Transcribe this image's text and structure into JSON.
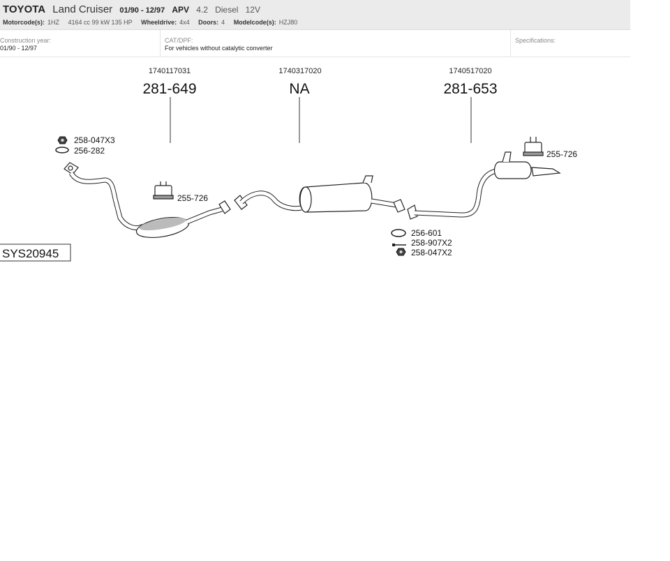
{
  "vehicle": {
    "brand": "TOYOTA",
    "model": "Land Cruiser",
    "years": "01/90 - 12/97",
    "type_label": "APV",
    "engine_l": "4.2",
    "fuel": "Diesel",
    "valves": "12V"
  },
  "specs_row": [
    {
      "key": "Motorcode(s):",
      "value": "1HZ"
    },
    {
      "key": "",
      "value": "4164 cc   99 kW   135 HP"
    },
    {
      "key": "Wheeldrive:",
      "value": "4x4"
    },
    {
      "key": "Doors:",
      "value": "4"
    },
    {
      "key": "Modelcode(s):",
      "value": "HZJ80"
    }
  ],
  "info": {
    "construction_label": "Construction year:",
    "construction_value": "01/90 - 12/97",
    "cat_label": "CAT/DPF:",
    "cat_value": "For vehicles without catalytic converter",
    "spec_label": "Specifications:"
  },
  "diagram": {
    "system_code": "SYS20945",
    "parts": [
      {
        "oem": "1740117031",
        "code": "281-649"
      },
      {
        "oem": "1740317020",
        "code": "NA"
      },
      {
        "oem": "1740517020",
        "code": "281-653"
      }
    ],
    "labels": {
      "front_nut": "258-047X3",
      "front_gasket": "256-282",
      "rubber_front": "255-726",
      "rubber_rear": "255-726",
      "ring": "256-601",
      "bolt": "258-907X2",
      "nut_rear": "258-047X2"
    }
  }
}
